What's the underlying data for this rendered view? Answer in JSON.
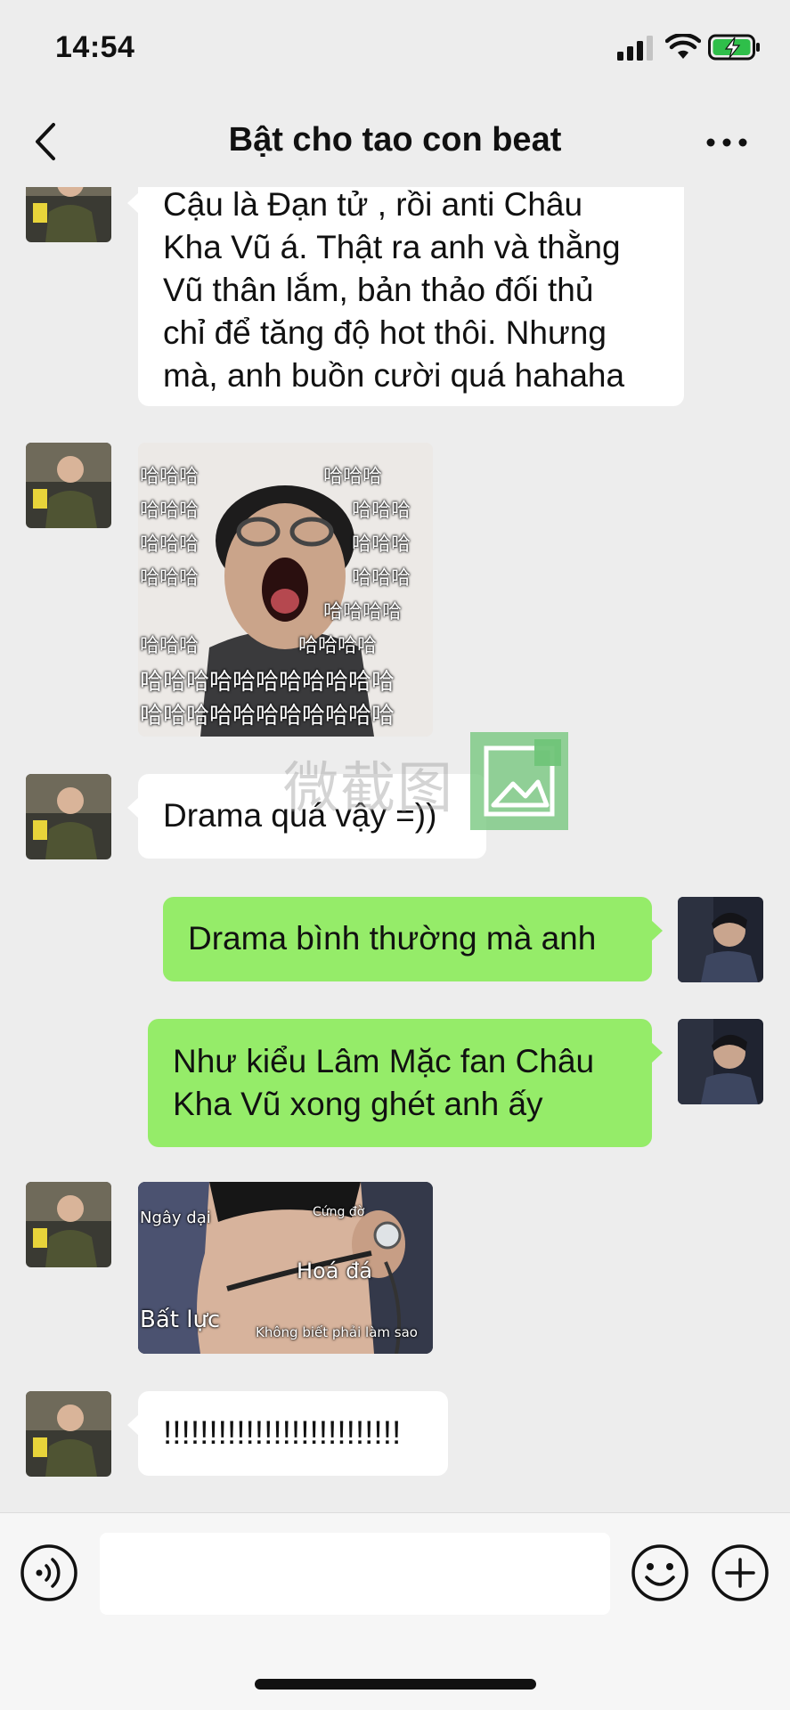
{
  "status_bar": {
    "time": "14:54",
    "battery_charging": true,
    "battery_color": "#2fbf4a"
  },
  "nav": {
    "title": "Bật cho tao con beat",
    "back_icon": "chevron-left-icon",
    "more_icon": "more-dots-icon"
  },
  "colors": {
    "background": "#ededed",
    "own_bubble": "#95ec69",
    "other_bubble": "#ffffff",
    "watermark_icon": "#70c478"
  },
  "messages": [
    {
      "sender": "other",
      "type": "text",
      "lines": [
        "Cậu là Đạn tử , rồi anti Châu",
        "Kha Vũ á. Thật ra anh và thằng",
        "Vũ thân lắm, bản thảo đối thủ",
        "chỉ để tăng độ hot thôi. Nhưng",
        "mà, anh buồn cười quá hahaha"
      ]
    },
    {
      "sender": "other",
      "type": "sticker",
      "subject": "laughing-man-sticker",
      "captions": [
        "哈哈哈",
        "哈哈哈",
        "哈哈哈",
        "哈哈哈",
        "哈哈哈",
        "哈哈哈",
        "哈哈哈",
        "哈哈哈",
        "哈哈哈哈",
        "哈哈哈",
        "哈哈哈哈",
        "哈哈哈哈哈哈哈哈哈哈哈",
        "哈哈哈哈哈哈哈哈哈哈哈"
      ]
    },
    {
      "sender": "other",
      "type": "text",
      "lines": [
        "Drama quá vậy =))"
      ]
    },
    {
      "sender": "me",
      "type": "text",
      "lines": [
        "Drama bình thường mà anh"
      ]
    },
    {
      "sender": "me",
      "type": "text",
      "lines": [
        "Như kiểu Lâm Mặc fan Châu",
        "Kha Vũ xong ghét anh ấy"
      ]
    },
    {
      "sender": "other",
      "type": "sticker",
      "subject": "headset-guy-sticker",
      "captions": [
        "Ngây dại",
        "Cứng đờ",
        "Hoá đá",
        "Bất lực",
        "Không biết phải làm sao"
      ]
    },
    {
      "sender": "other",
      "type": "text",
      "lines": [
        "!!!!!!!!!!!!!!!!!!!!!!!!!!"
      ]
    }
  ],
  "watermark": {
    "text": "微截图",
    "icon": "image-frame-icon"
  },
  "input_bar": {
    "voice_icon": "voice-input-icon",
    "input_value": "",
    "emoji_icon": "emoji-icon",
    "plus_icon": "plus-circle-icon"
  }
}
